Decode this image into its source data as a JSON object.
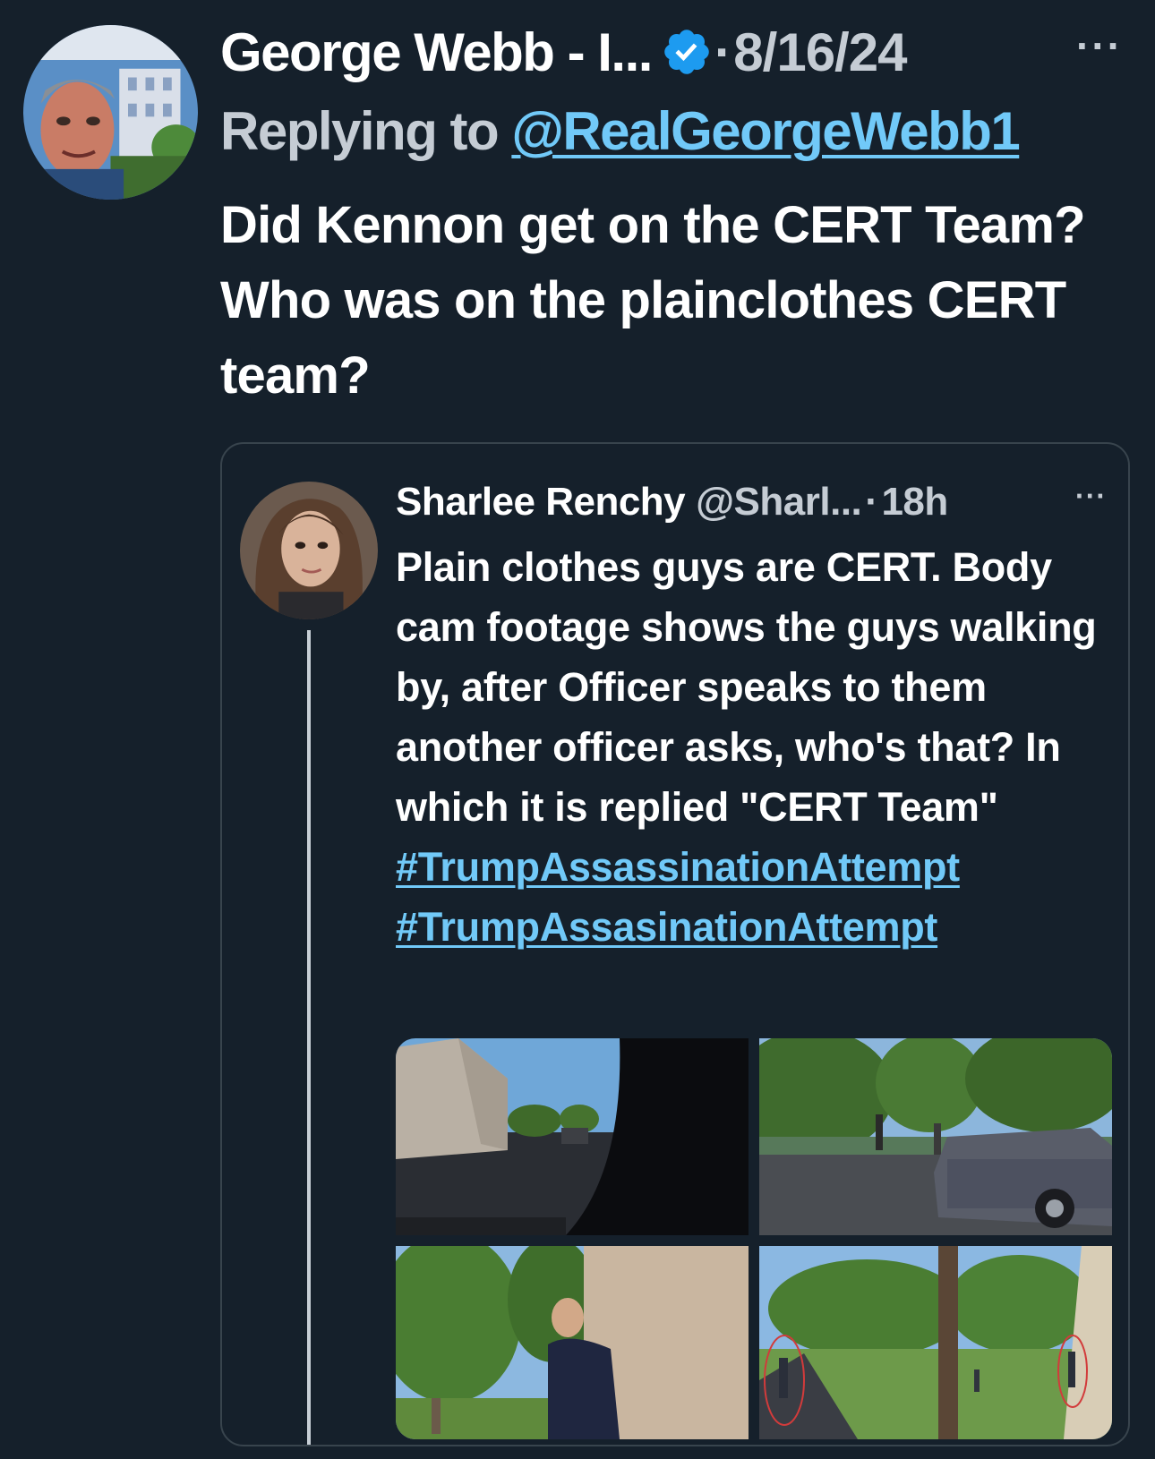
{
  "tweet": {
    "author_name": "George Webb - I...",
    "separator": "·",
    "date": "8/16/24",
    "more_label": "···",
    "reply_prefix": "Replying to",
    "reply_handle": "@RealGeorgeWebb1",
    "text": "Did Kennon get on the CERT Team?  Who was on the plainclothes CERT team?"
  },
  "quote": {
    "author_name": "Sharlee Renchy",
    "handle": "@Sharl...",
    "separator": "·",
    "time": "18h",
    "more_label": "···",
    "text": "Plain clothes guys are CERT. Body cam footage shows the guys walking by, after Officer speaks to them another officer asks, who's that? In which it is replied \"CERT Team\"",
    "hashtags": [
      "#TrumpAssassinationAttempt",
      "#TrumpAssasinationAttempt"
    ]
  },
  "icons": {
    "verified": "verified-badge-icon",
    "more": "more-options-icon"
  },
  "colors": {
    "background": "#15202b",
    "text": "#ffffff",
    "secondary_text": "#c5ccd4",
    "link": "#71c9f8",
    "verified_badge": "#1d9bf0",
    "border": "#38444d"
  }
}
